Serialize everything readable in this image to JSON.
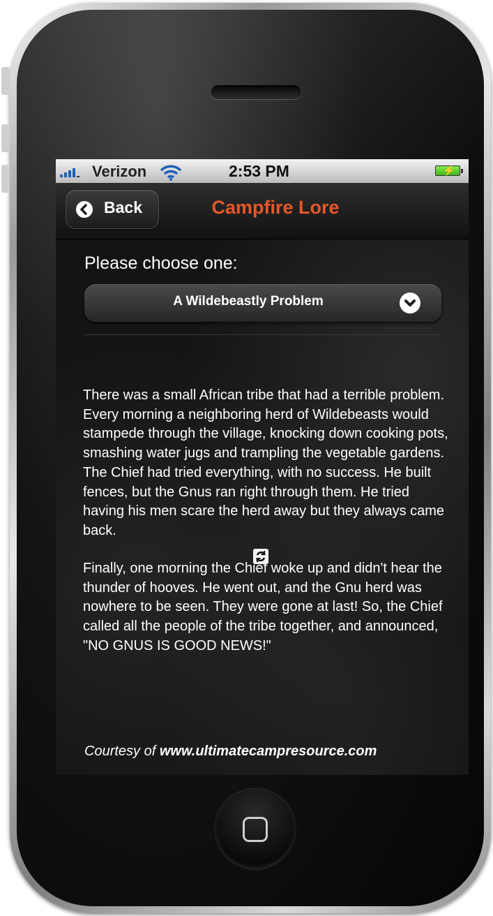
{
  "status_bar": {
    "carrier": "Verizon",
    "time": "2:53 PM"
  },
  "nav": {
    "back_label": "Back",
    "title": "Campfire Lore"
  },
  "picker": {
    "prompt": "Please choose one:",
    "selected": "A Wildebeastly Problem"
  },
  "story": {
    "paragraph_1": "There was a small African tribe that had a terrible problem. Every morning a neighboring herd of Wildebeasts would stampede through the village, knocking down cooking pots, smashing water jugs and trampling the vegetable gardens. The Chief had tried everything, with no success. He built fences, but the Gnus ran right through them. He tried having his men scare the herd away but they always came back.",
    "paragraph_2": "Finally, one morning the Chief woke up and didn't hear the thunder of hooves. He went out, and the Gnu herd was nowhere to be seen. They were gone at last! So, the Chief called all the people of the tribe together, and announced, \"NO GNUS IS GOOD NEWS!\""
  },
  "footer": {
    "courtesy_prefix": "Courtesy of",
    "courtesy_site": "www.ultimatecampresource.com"
  },
  "colors": {
    "title": "#e8572a",
    "text": "#ffffff",
    "background": "#141414"
  },
  "icons": {
    "signal": "signal-bars-icon",
    "wifi": "wifi-icon",
    "battery": "battery-charging-icon",
    "back": "chevron-left-icon",
    "dropdown": "chevron-down-icon",
    "refresh": "refresh-icon"
  }
}
